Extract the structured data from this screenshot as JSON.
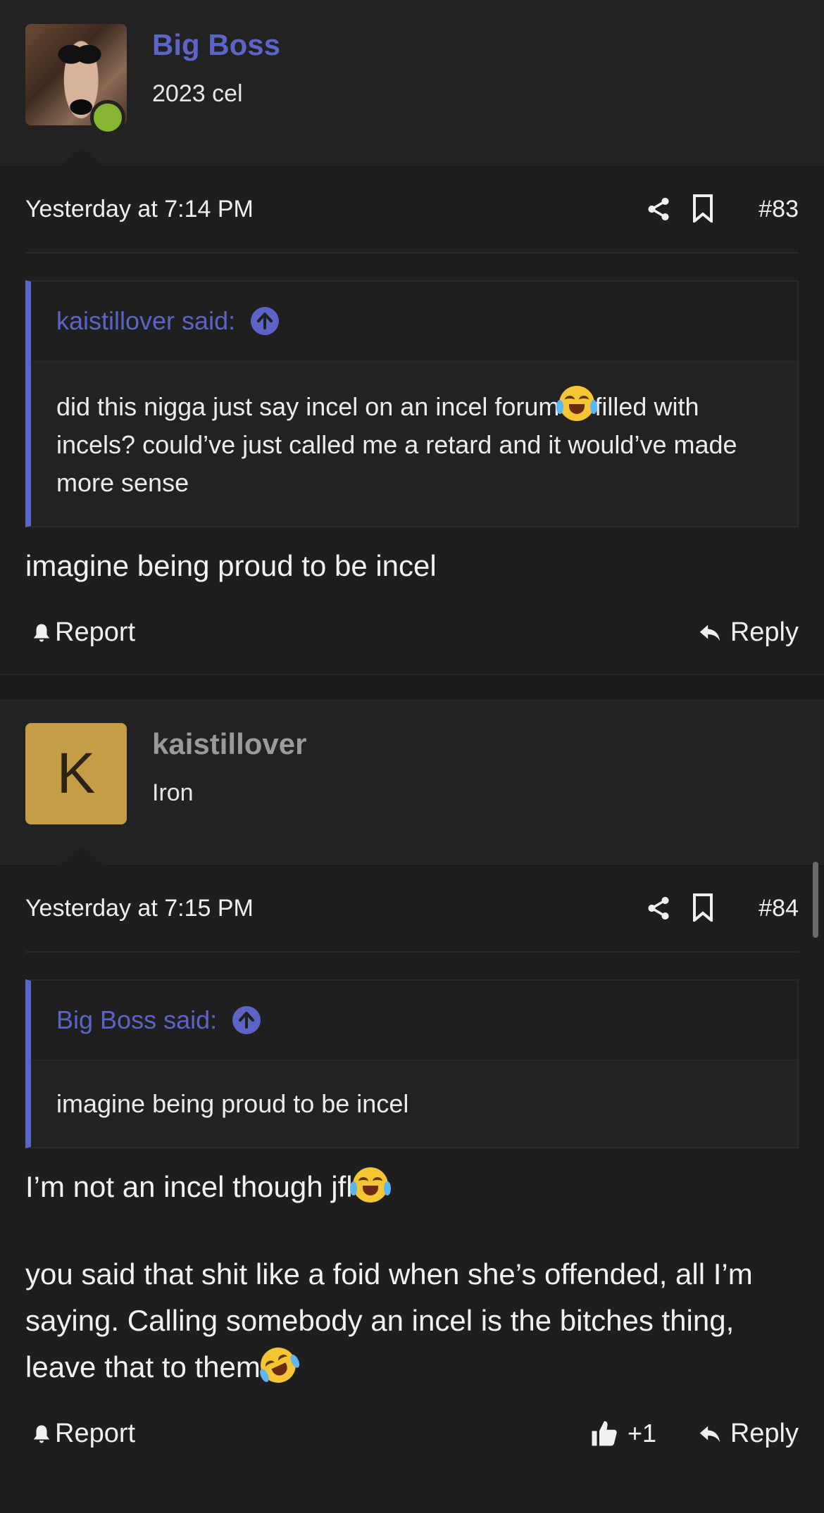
{
  "posts": [
    {
      "username": "Big Boss",
      "user_title": "2023 cel",
      "date": "Yesterday at 7:14 PM",
      "post_number": "#83",
      "quote_author": "kaistillover said:",
      "quote_text_1": "did this nigga just say incel on an incel forum",
      "quote_text_2": "filled with incels? could’ve just called me a retard and it would’ve made more sense",
      "message": "imagine being proud to be incel",
      "report_label": "Report",
      "reply_label": "Reply"
    },
    {
      "username": "kaistillover",
      "avatar_letter": "K",
      "user_title": "Iron",
      "date": "Yesterday at 7:15 PM",
      "post_number": "#84",
      "quote_author": "Big Boss said:",
      "quote_text": "imagine being proud to be incel",
      "message_1": "I’m not an incel though jfl",
      "message_2": "you said that shit like a foid when she’s offended, all I’m saying. Calling somebody an incel is the bitches thing, leave that to them",
      "report_label": "Report",
      "like_count": "+1",
      "reply_label": "Reply"
    }
  ],
  "colors": {
    "accent": "#5c64c6",
    "online": "#86b534",
    "avatar_k": "#c59d46"
  }
}
